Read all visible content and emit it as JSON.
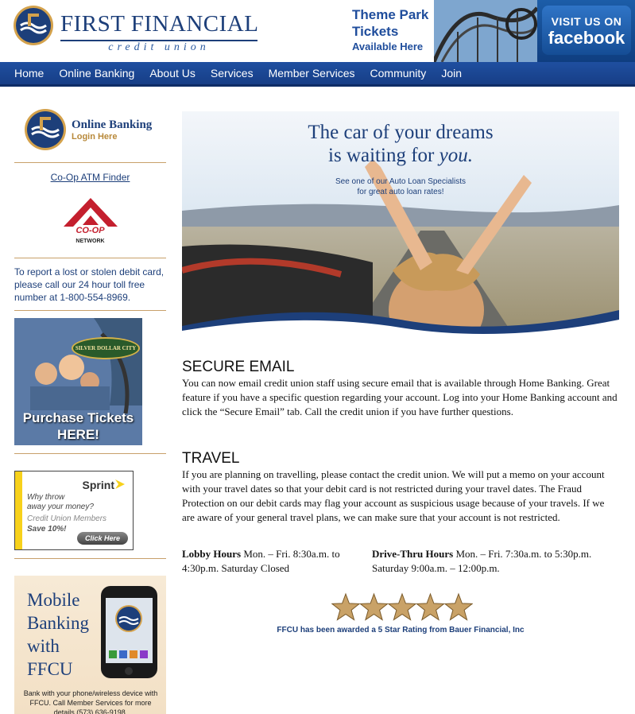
{
  "brand": {
    "name": "FIRST FINANCIAL",
    "sub": "credit union",
    "primary_color": "#1d3f7a",
    "accent_color": "#b8893a",
    "logo_icon": "ffcu-seal-icon"
  },
  "header": {
    "promo_title_1": "Theme Park",
    "promo_title_2": "Tickets",
    "promo_sub": "Available Here",
    "facebook_visit": "VISIT US ON",
    "facebook_name": "facebook"
  },
  "nav": {
    "items": [
      "Home",
      "Online Banking",
      "About Us",
      "Services",
      "Member Services",
      "Community",
      "Join"
    ]
  },
  "sidebar": {
    "online_banking_title": "Online Banking",
    "online_banking_login": "Login Here",
    "atm_link": "Co-Op ATM Finder",
    "coop_label": "CO-OP",
    "coop_network": "NETWORK",
    "report_text": "To report a lost or stolen debit card, please call our 24 hour toll free number at 1-800-554-8969.",
    "sdc_sign": "SILVER DOLLAR CITY",
    "sdc_cta_1": "Purchase Tickets",
    "sdc_cta_2": "HERE!",
    "sprint_logo": "Sprint",
    "sprint_q_1": "Why throw",
    "sprint_q_2": "away your money?",
    "sprint_members": "Credit Union Members",
    "sprint_save": "Save 10%!",
    "sprint_button": "Click Here",
    "mobile_title_1": "Mobile",
    "mobile_title_2": "Banking",
    "mobile_title_3": "with",
    "mobile_title_4": "FFCU",
    "mobile_desc": "Bank with your phone/wireless device with FFCU. Call Member Services for more details (573) 636-9198."
  },
  "hero": {
    "headline_1": "The car of your dreams",
    "headline_2a": "is waiting for ",
    "headline_2b": "you.",
    "sub_1": "See one of our Auto Loan Specialists",
    "sub_2": "for great auto loan rates!"
  },
  "content": {
    "email_heading": "SECURE EMAIL",
    "email_body": "You can now email credit union staff using secure email that is available through Home Banking. Great feature if you have a specific question regarding your account. Log into your Home Banking account and click the “Secure Email” tab. Call the credit union if you have further questions.",
    "travel_heading": "TRAVEL",
    "travel_body": "If you are planning on travelling, please contact the credit union. We will put a memo on your account with your travel dates so that your debit card is not restricted during your travel dates. The Fraud Protection on our debit cards may flag your account as suspicious usage because of your travels. If we are aware of your general travel plans, we can make sure that your account is not restricted.",
    "lobby_label": "Lobby Hours",
    "lobby_text": " Mon. – Fri. 8:30a.m. to 4:30p.m. Saturday Closed",
    "drive_label": "Drive-Thru Hours",
    "drive_text": " Mon. – Fri. 7:30a.m. to 5:30p.m. Saturday 9:00a.m. – 12:00p.m.",
    "rating_stars": 5,
    "award_text": "FFCU has been awarded a 5 Star Rating from Bauer Financial, Inc"
  }
}
